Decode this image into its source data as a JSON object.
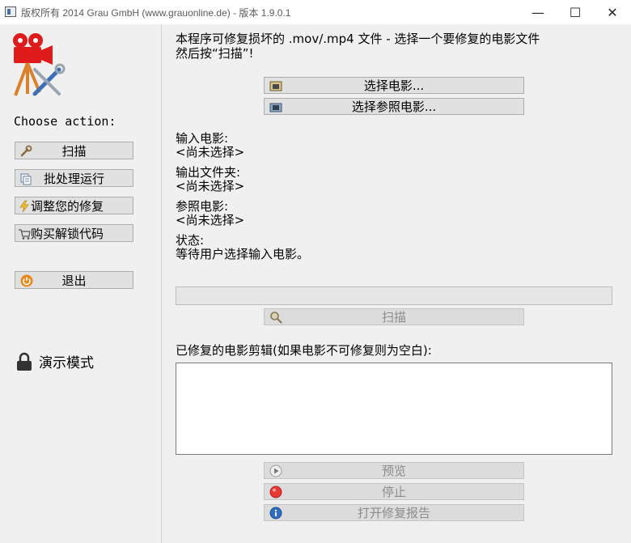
{
  "window": {
    "title": "版权所有 2014 Grau GmbH (www.grauonline.de) - 版本 1.9.0.1",
    "minimize_glyph": "—",
    "maximize_glyph": "☐",
    "close_glyph": "✕"
  },
  "sidebar": {
    "logo_icon": "camera-tools-logo-icon",
    "choose_label": "Choose action:",
    "buttons": [
      {
        "label": "扫描",
        "icon": "wrench-icon"
      },
      {
        "label": "批处理运行",
        "icon": "copy-pages-icon"
      },
      {
        "label": "调整您的修复",
        "icon": "lightning-icon"
      },
      {
        "label": "购买解锁代码",
        "icon": "shopping-cart-icon"
      }
    ],
    "exit_label": "退出",
    "exit_icon": "power-icon",
    "demo_label": "演示模式",
    "demo_icon": "padlock-icon"
  },
  "main": {
    "instruction": "本程序可修复损坏的 .mov/.mp4 文件 - 选择一个要修复的电影文件\n然后按“扫描”!",
    "select_movie_label": "选择电影...",
    "select_reference_label": "选择参照电影...",
    "input_movie_label": "输入电影:",
    "input_movie_value": "<尚未选择>",
    "output_folder_label": "输出文件夹:",
    "output_folder_value": "<尚未选择>",
    "reference_movie_label": "参照电影:",
    "reference_movie_value": "<尚未选择>",
    "status_label": "状态:",
    "status_value": "等待用户选择输入电影。",
    "progress_fraction": 0,
    "scan_label": "扫描",
    "clips_label": "已修复的电影剪辑(如果电影不可修复则为空白):",
    "preview_label": "预览",
    "stop_label": "停止",
    "open_report_label": "打开修复报告"
  },
  "colors": {
    "logo_red": "#e01b1b",
    "accent_orange": "#d9822b",
    "stop_red": "#e53935",
    "info_blue": "#2f6fc2"
  }
}
